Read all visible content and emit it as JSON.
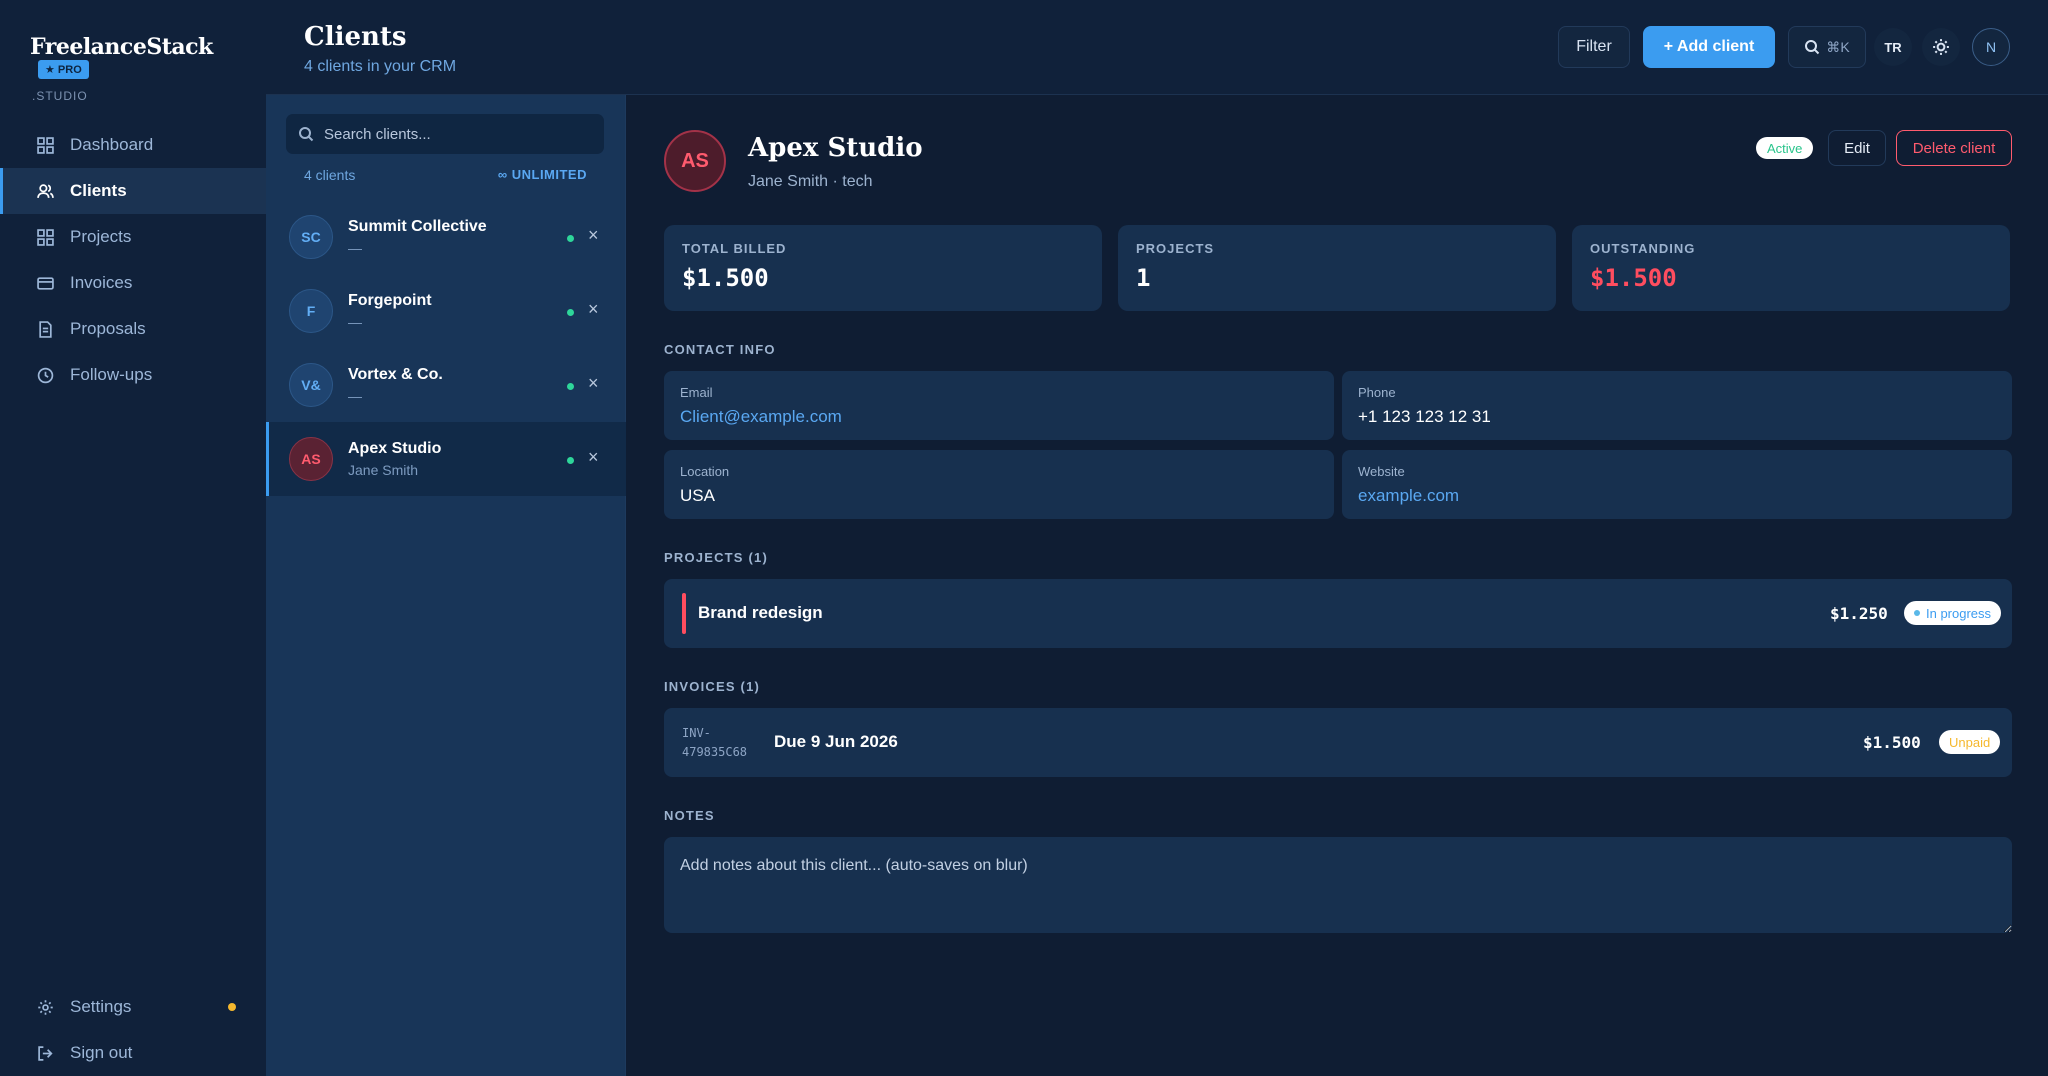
{
  "brand": {
    "name": "FreelanceStack",
    "badge": "★ PRO",
    "sub": ".STUDIO"
  },
  "nav": {
    "items": [
      {
        "label": "Dashboard",
        "icon": "grid-icon"
      },
      {
        "label": "Clients",
        "icon": "users-icon"
      },
      {
        "label": "Projects",
        "icon": "grid-icon"
      },
      {
        "label": "Invoices",
        "icon": "card-icon"
      },
      {
        "label": "Proposals",
        "icon": "document-icon"
      },
      {
        "label": "Follow-ups",
        "icon": "clock-icon"
      }
    ],
    "settings": "Settings",
    "signout": "Sign out"
  },
  "header": {
    "title": "Clients",
    "subtitle": "4 clients in your CRM",
    "filter": "Filter",
    "add": "+ Add client",
    "shortcut": "⌘K",
    "lang": "TR",
    "user_initial": "N"
  },
  "list": {
    "search_placeholder": "Search clients...",
    "count": "4 clients",
    "limit": "∞ UNLIMITED",
    "clients": [
      {
        "initials": "SC",
        "name": "Summit Collective",
        "contact": "—"
      },
      {
        "initials": "F",
        "name": "Forgepoint",
        "contact": "—"
      },
      {
        "initials": "V&",
        "name": "Vortex & Co.",
        "contact": "—"
      },
      {
        "initials": "AS",
        "name": "Apex Studio",
        "contact": "Jane Smith"
      }
    ],
    "remove_glyph": "×"
  },
  "detail": {
    "initials": "AS",
    "name": "Apex Studio",
    "sub": "Jane Smith · tech",
    "status": "Active",
    "edit": "Edit",
    "delete": "Delete client",
    "stats": [
      {
        "label": "TOTAL BILLED",
        "value": "$1.500"
      },
      {
        "label": "PROJECTS",
        "value": "1"
      },
      {
        "label": "OUTSTANDING",
        "value": "$1.500"
      }
    ],
    "contact_label": "CONTACT INFO",
    "contact": {
      "email_key": "Email",
      "email": "Client@example.com",
      "phone_key": "Phone",
      "phone": "+1 123 123 12 31",
      "location_key": "Location",
      "location": "USA",
      "website_key": "Website",
      "website": "example.com"
    },
    "projects_label": "PROJECTS (1)",
    "project": {
      "name": "Brand redesign",
      "amount": "$1.250",
      "status": "In progress"
    },
    "invoices_label": "INVOICES (1)",
    "invoice": {
      "number": "INV-479835C68",
      "due": "Due 9 Jun 2026",
      "amount": "$1.500",
      "status": "Unpaid"
    },
    "notes_label": "NOTES",
    "notes_placeholder": "Add notes about this client... (auto-saves on blur)"
  },
  "colors": {
    "accent": "#3b9cf0",
    "danger": "#ff4d5f",
    "success": "#2ed69a",
    "warning": "#f5b82e"
  }
}
